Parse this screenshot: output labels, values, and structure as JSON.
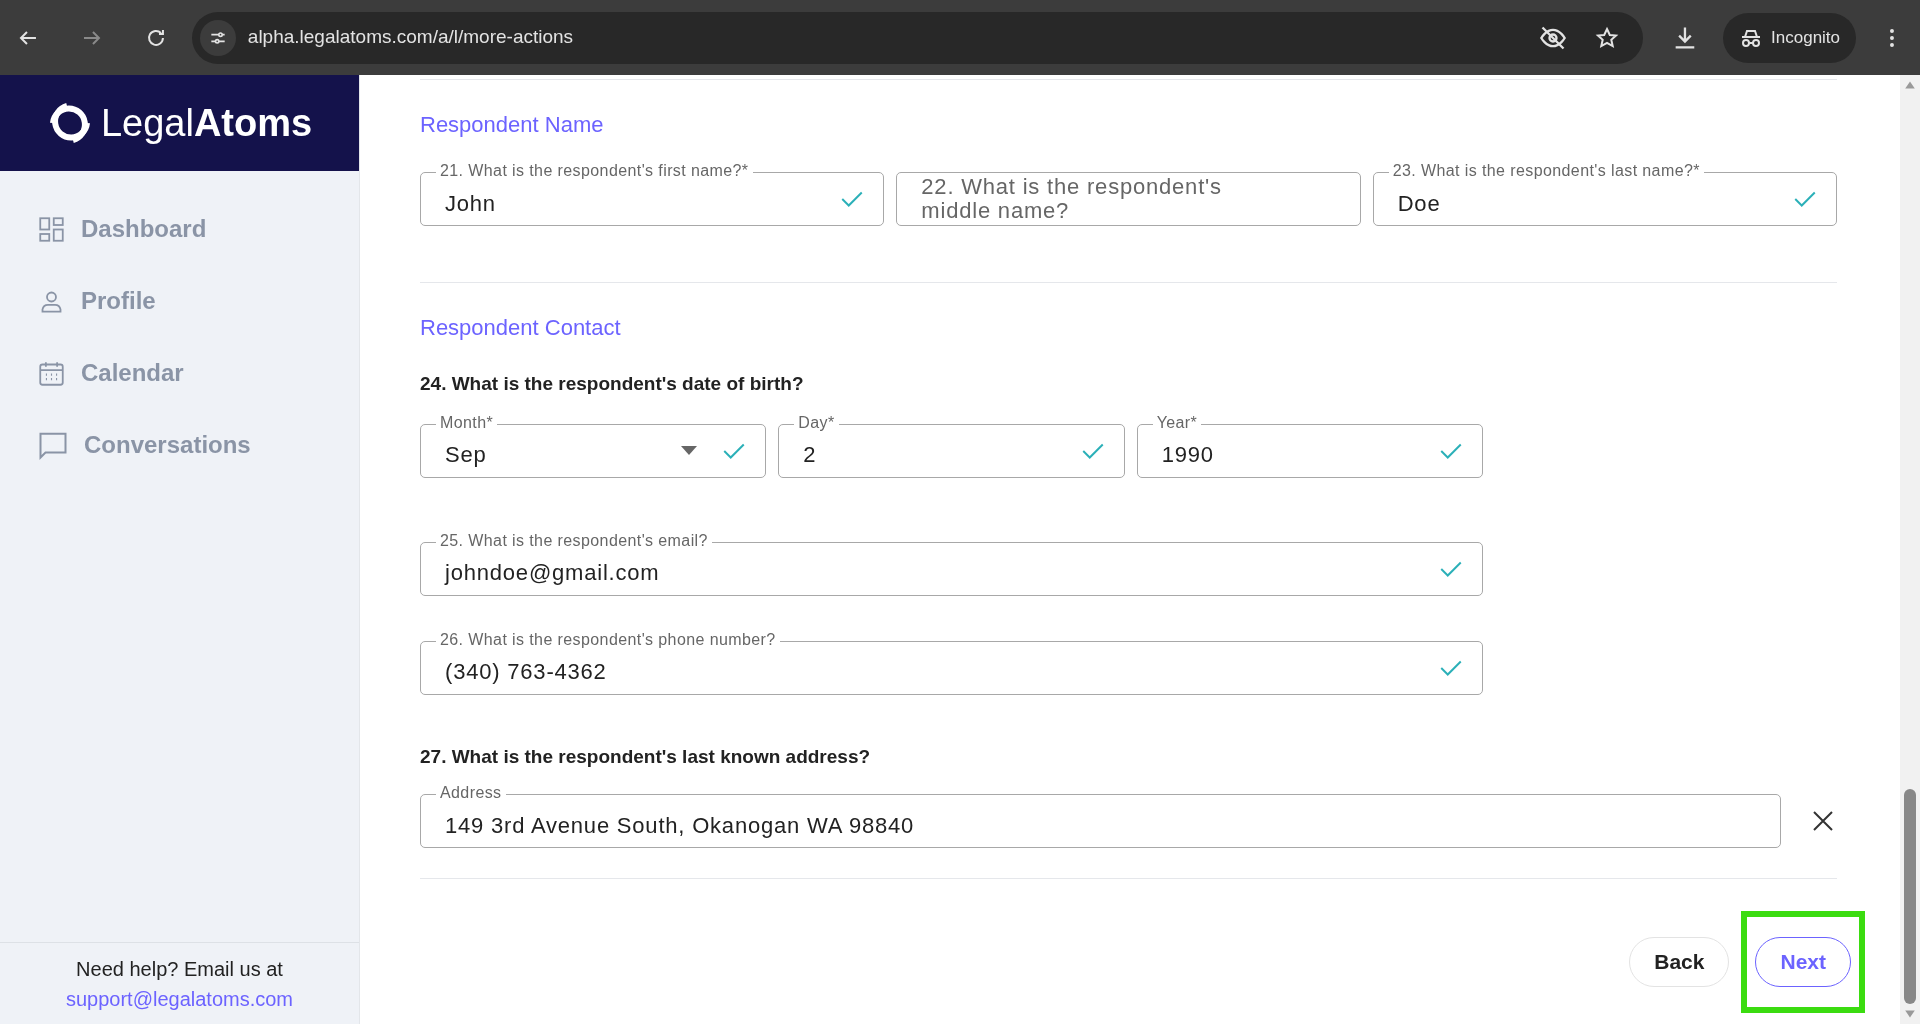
{
  "browser": {
    "url": "alpha.legalatoms.com/a/l/more-actions",
    "profile": "Incognito"
  },
  "sidebar": {
    "logo": {
      "light": "Legal",
      "bold": "Atoms"
    },
    "items": [
      {
        "label": "Dashboard",
        "kind": "grid"
      },
      {
        "label": "Profile",
        "kind": "person"
      },
      {
        "label": "Calendar",
        "kind": "calendar"
      },
      {
        "label": "Conversations",
        "kind": "chat"
      }
    ],
    "help": {
      "text": "Need help? Email us at",
      "email": "support@legalatoms.com"
    }
  },
  "sections": [
    {
      "title": "Respondent Name",
      "items": [
        {
          "kind": "row",
          "wide": true,
          "fields": [
            {
              "kind": "text",
              "label": "21. What is the respondent's first name?*",
              "value": "John",
              "valid": true
            },
            {
              "kind": "text",
              "placeholder": "22. What is the respondent's middle name?",
              "valid": false
            },
            {
              "kind": "text",
              "label": "23. What is the respondent's last name?*",
              "value": "Doe",
              "valid": true
            }
          ]
        }
      ]
    },
    {
      "title": "Respondent Contact",
      "items": [
        {
          "kind": "question",
          "text": "24. What is the respondent's date of birth?"
        },
        {
          "kind": "row",
          "wide": false,
          "fields": [
            {
              "kind": "select",
              "label": "Month*",
              "value": "Sep",
              "valid": true
            },
            {
              "kind": "text",
              "label": "Day*",
              "value": "2",
              "valid": true
            },
            {
              "kind": "text",
              "label": "Year*",
              "value": "1990",
              "valid": true
            }
          ]
        },
        {
          "kind": "row",
          "wide": false,
          "fields": [
            {
              "kind": "text",
              "label": "25. What is the respondent's email?",
              "value": "johndoe@gmail.com",
              "valid": true
            }
          ]
        },
        {
          "kind": "row",
          "wide": false,
          "fields": [
            {
              "kind": "text",
              "label": "26. What is the respondent's phone number?",
              "value": "(340) 763-4362",
              "valid": true
            }
          ]
        },
        {
          "kind": "question",
          "text": "27. What is the respondent's last known address?"
        },
        {
          "kind": "row",
          "wide": true,
          "clearable": true,
          "fields": [
            {
              "kind": "text",
              "label": "Address",
              "value": "149 3rd Avenue South, Okanogan WA 98840",
              "valid": false
            }
          ]
        }
      ]
    }
  ],
  "buttons": [
    {
      "label": "Back",
      "kind": "secondary",
      "highlighted": false
    },
    {
      "label": "Next",
      "kind": "primary",
      "highlighted": true
    }
  ]
}
